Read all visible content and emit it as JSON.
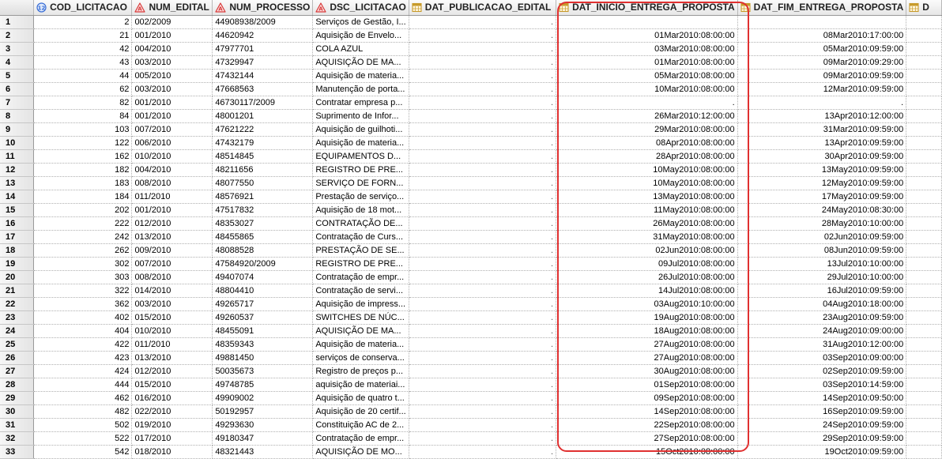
{
  "columns": [
    {
      "key": "COD_LICITACAO",
      "label": "COD_LICITACAO",
      "icon": "numeric-column-icon"
    },
    {
      "key": "NUM_EDITAL",
      "label": "NUM_EDITAL",
      "icon": "character-column-icon"
    },
    {
      "key": "NUM_PROCESSO",
      "label": "NUM_PROCESSO",
      "icon": "character-column-icon"
    },
    {
      "key": "DSC_LICITACAO",
      "label": "DSC_LICITACAO",
      "icon": "character-column-icon"
    },
    {
      "key": "DAT_PUBLICACAO_EDITAL",
      "label": "DAT_PUBLICACAO_EDITAL",
      "icon": "date-column-icon"
    },
    {
      "key": "DAT_INICIO_ENTREGA_PROPOSTA",
      "label": "DAT_INICIO_ENTREGA_PROPOSTA",
      "icon": "date-column-icon"
    },
    {
      "key": "DAT_FIM_ENTREGA_PROPOSTA",
      "label": "DAT_FIM_ENTREGA_PROPOSTA",
      "icon": "date-column-icon"
    },
    {
      "key": "next",
      "label": "D",
      "icon": "date-column-icon"
    }
  ],
  "icon_colors": {
    "numeric": "#3b6fd6",
    "character": "#d83a3a",
    "date": "#c79a2a"
  },
  "highlight_color": "#e03030",
  "rows": [
    {
      "n": "1",
      "cod": "2",
      "edital": "002/2009",
      "processo": "44908938/2009",
      "dsc": "Serviços de Gestão, I...",
      "pub": ".",
      "ini": "",
      "fim": ""
    },
    {
      "n": "2",
      "cod": "21",
      "edital": "001/2010",
      "processo": "44620942",
      "dsc": "Aquisição de Envelo...",
      "pub": ".",
      "ini": "01Mar2010:08:00:00",
      "fim": "08Mar2010:17:00:00"
    },
    {
      "n": "3",
      "cod": "42",
      "edital": "004/2010",
      "processo": "47977701",
      "dsc": "COLA AZUL",
      "pub": ".",
      "ini": "03Mar2010:08:00:00",
      "fim": "05Mar2010:09:59:00"
    },
    {
      "n": "4",
      "cod": "43",
      "edital": "003/2010",
      "processo": "47329947",
      "dsc": "AQUISIÇÃO DE MA...",
      "pub": ".",
      "ini": "01Mar2010:08:00:00",
      "fim": "09Mar2010:09:29:00"
    },
    {
      "n": "5",
      "cod": "44",
      "edital": "005/2010",
      "processo": "47432144",
      "dsc": "Aquisição de materia...",
      "pub": ".",
      "ini": "05Mar2010:08:00:00",
      "fim": "09Mar2010:09:59:00"
    },
    {
      "n": "6",
      "cod": "62",
      "edital": "003/2010",
      "processo": "47668563",
      "dsc": "Manutenção de porta...",
      "pub": ".",
      "ini": "10Mar2010:08:00:00",
      "fim": "12Mar2010:09:59:00"
    },
    {
      "n": "7",
      "cod": "82",
      "edital": "001/2010",
      "processo": "46730117/2009",
      "dsc": "Contratar empresa p...",
      "pub": ".",
      "ini": ".",
      "fim": "."
    },
    {
      "n": "8",
      "cod": "84",
      "edital": "001/2010",
      "processo": "48001201",
      "dsc": "Suprimento de Infor...",
      "pub": ".",
      "ini": "26Mar2010:12:00:00",
      "fim": "13Apr2010:12:00:00"
    },
    {
      "n": "9",
      "cod": "103",
      "edital": "007/2010",
      "processo": "47621222",
      "dsc": "Aquisição de guilhoti...",
      "pub": ".",
      "ini": "29Mar2010:08:00:00",
      "fim": "31Mar2010:09:59:00"
    },
    {
      "n": "10",
      "cod": "122",
      "edital": "006/2010",
      "processo": "47432179",
      "dsc": "Aquisição de materia...",
      "pub": ".",
      "ini": "08Apr2010:08:00:00",
      "fim": "13Apr2010:09:59:00"
    },
    {
      "n": "11",
      "cod": "162",
      "edital": "010/2010",
      "processo": "48514845",
      "dsc": "EQUIPAMENTOS D...",
      "pub": ".",
      "ini": "28Apr2010:08:00:00",
      "fim": "30Apr2010:09:59:00"
    },
    {
      "n": "12",
      "cod": "182",
      "edital": "004/2010",
      "processo": "48211656",
      "dsc": "REGISTRO DE PRE...",
      "pub": ".",
      "ini": "10May2010:08:00:00",
      "fim": "13May2010:09:59:00"
    },
    {
      "n": "13",
      "cod": "183",
      "edital": "008/2010",
      "processo": "48077550",
      "dsc": "SERVIÇO DE FORN...",
      "pub": ".",
      "ini": "10May2010:08:00:00",
      "fim": "12May2010:09:59:00"
    },
    {
      "n": "14",
      "cod": "184",
      "edital": "011/2010",
      "processo": "48576921",
      "dsc": "Prestação de serviço...",
      "pub": ".",
      "ini": "13May2010:08:00:00",
      "fim": "17May2010:09:59:00"
    },
    {
      "n": "15",
      "cod": "202",
      "edital": "001/2010",
      "processo": "47517832",
      "dsc": "Aquisição de 18 mot...",
      "pub": ".",
      "ini": "11May2010:08:00:00",
      "fim": "24May2010:08:30:00"
    },
    {
      "n": "16",
      "cod": "222",
      "edital": "012/2010",
      "processo": "48353027",
      "dsc": "CONTRATAÇÃO DE...",
      "pub": ".",
      "ini": "26May2010:08:00:00",
      "fim": "28May2010:10:00:00"
    },
    {
      "n": "17",
      "cod": "242",
      "edital": "013/2010",
      "processo": "48455865",
      "dsc": "Contratação de Curs...",
      "pub": ".",
      "ini": "31May2010:08:00:00",
      "fim": "02Jun2010:09:59:00"
    },
    {
      "n": "18",
      "cod": "262",
      "edital": "009/2010",
      "processo": "48088528",
      "dsc": "PRESTAÇÃO DE SE...",
      "pub": ".",
      "ini": "02Jun2010:08:00:00",
      "fim": "08Jun2010:09:59:00"
    },
    {
      "n": "19",
      "cod": "302",
      "edital": "007/2010",
      "processo": "47584920/2009",
      "dsc": "REGISTRO DE PRE...",
      "pub": ".",
      "ini": "09Jul2010:08:00:00",
      "fim": "13Jul2010:10:00:00"
    },
    {
      "n": "20",
      "cod": "303",
      "edital": "008/2010",
      "processo": "49407074",
      "dsc": "Contratação de empr...",
      "pub": ".",
      "ini": "26Jul2010:08:00:00",
      "fim": "29Jul2010:10:00:00"
    },
    {
      "n": "21",
      "cod": "322",
      "edital": "014/2010",
      "processo": "48804410",
      "dsc": "Contratação de servi...",
      "pub": ".",
      "ini": "14Jul2010:08:00:00",
      "fim": "16Jul2010:09:59:00"
    },
    {
      "n": "22",
      "cod": "362",
      "edital": "003/2010",
      "processo": "49265717",
      "dsc": "Aquisição de impress...",
      "pub": ".",
      "ini": "03Aug2010:10:00:00",
      "fim": "04Aug2010:18:00:00"
    },
    {
      "n": "23",
      "cod": "402",
      "edital": "015/2010",
      "processo": "49260537",
      "dsc": "SWITCHES DE NÚC...",
      "pub": ".",
      "ini": "19Aug2010:08:00:00",
      "fim": "23Aug2010:09:59:00"
    },
    {
      "n": "24",
      "cod": "404",
      "edital": "010/2010",
      "processo": "48455091",
      "dsc": "AQUISIÇÃO DE MA...",
      "pub": ".",
      "ini": "18Aug2010:08:00:00",
      "fim": "24Aug2010:09:00:00"
    },
    {
      "n": "25",
      "cod": "422",
      "edital": "011/2010",
      "processo": "48359343",
      "dsc": "Aquisição de materia...",
      "pub": ".",
      "ini": "27Aug2010:08:00:00",
      "fim": "31Aug2010:12:00:00"
    },
    {
      "n": "26",
      "cod": "423",
      "edital": "013/2010",
      "processo": "49881450",
      "dsc": "serviços de conserva...",
      "pub": ".",
      "ini": "27Aug2010:08:00:00",
      "fim": "03Sep2010:09:00:00"
    },
    {
      "n": "27",
      "cod": "424",
      "edital": "012/2010",
      "processo": "50035673",
      "dsc": "Registro de preços p...",
      "pub": ".",
      "ini": "30Aug2010:08:00:00",
      "fim": "02Sep2010:09:59:00"
    },
    {
      "n": "28",
      "cod": "444",
      "edital": "015/2010",
      "processo": "49748785",
      "dsc": "aquisição de materiai...",
      "pub": ".",
      "ini": "01Sep2010:08:00:00",
      "fim": "03Sep2010:14:59:00"
    },
    {
      "n": "29",
      "cod": "462",
      "edital": "016/2010",
      "processo": "49909002",
      "dsc": "Aquisição de quatro t...",
      "pub": ".",
      "ini": "09Sep2010:08:00:00",
      "fim": "14Sep2010:09:50:00"
    },
    {
      "n": "30",
      "cod": "482",
      "edital": "022/2010",
      "processo": "50192957",
      "dsc": "Aquisição de 20 certif...",
      "pub": ".",
      "ini": "14Sep2010:08:00:00",
      "fim": "16Sep2010:09:59:00"
    },
    {
      "n": "31",
      "cod": "502",
      "edital": "019/2010",
      "processo": "49293630",
      "dsc": "Constituição AC de 2...",
      "pub": ".",
      "ini": "22Sep2010:08:00:00",
      "fim": "24Sep2010:09:59:00"
    },
    {
      "n": "32",
      "cod": "522",
      "edital": "017/2010",
      "processo": "49180347",
      "dsc": "Contratação de empr...",
      "pub": ".",
      "ini": "27Sep2010:08:00:00",
      "fim": "29Sep2010:09:59:00"
    },
    {
      "n": "33",
      "cod": "542",
      "edital": "018/2010",
      "processo": "48321443",
      "dsc": "AQUISIÇÃO DE MO...",
      "pub": ".",
      "ini": "15Oct2010:08:00:00",
      "fim": "19Oct2010:09:59:00"
    }
  ]
}
